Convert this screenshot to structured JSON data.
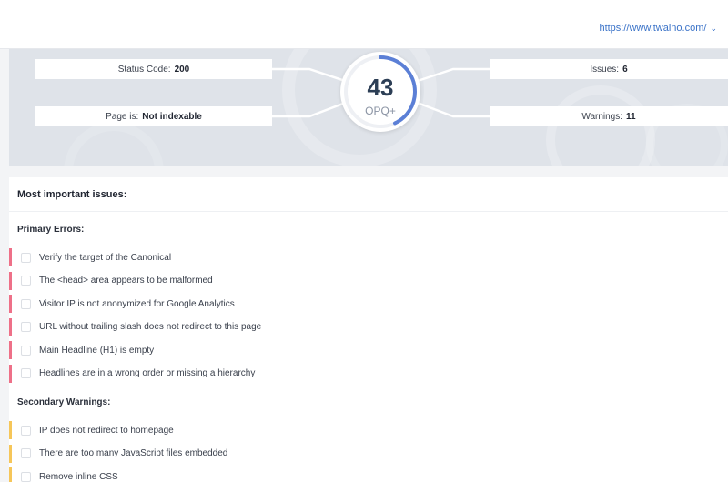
{
  "header": {
    "url_selector": "https://www.twaino.com/",
    "chevron_icon": "chevron-down-icon"
  },
  "stats": {
    "status_code_label": "Status Code:",
    "status_code_value": "200",
    "page_is_label": "Page is:",
    "page_is_value": "Not indexable",
    "issues_label": "Issues:",
    "issues_value": "6",
    "warnings_label": "Warnings:",
    "warnings_value": "11"
  },
  "score": {
    "value": "43",
    "label": "OPQ+",
    "fraction": 0.43,
    "arc_color": "#5b7fd6",
    "track_color": "#eef0f4"
  },
  "issues_panel": {
    "title": "Most important issues:",
    "primary_label": "Primary Errors:",
    "secondary_label": "Secondary Warnings:",
    "primary_errors": [
      "Verify the target of the Canonical",
      "The <head> area appears to be malformed",
      "Visitor IP is not anonymized for Google Analytics",
      "URL without trailing slash does not redirect to this page",
      "Main Headline (H1) is empty",
      "Headlines are in a wrong order or missing a hierarchy"
    ],
    "secondary_warnings": [
      "IP does not redirect to homepage",
      "There are too many JavaScript files embedded",
      "Remove inline CSS"
    ],
    "error_color": "#ee7088",
    "warning_color": "#f6c659"
  }
}
